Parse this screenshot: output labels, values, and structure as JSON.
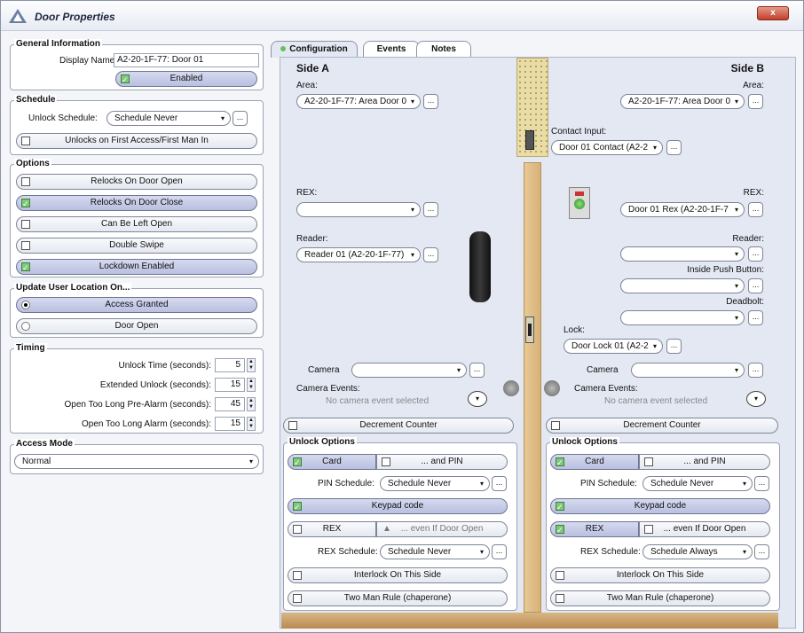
{
  "window": {
    "title": "Door Properties",
    "close_label": "x"
  },
  "general": {
    "title": "General Information",
    "display_name_label": "Display Name:",
    "display_name_value": "A2-20-1F-77: Door 01",
    "enabled_label": "Enabled"
  },
  "schedule": {
    "title": "Schedule",
    "unlock_label": "Unlock Schedule:",
    "unlock_value": "Schedule Never",
    "first_access_label": "Unlocks on First Access/First Man In"
  },
  "options": {
    "title": "Options",
    "items": [
      "Relocks On Door Open",
      "Relocks On Door Close",
      "Can Be Left Open",
      "Double Swipe",
      "Lockdown Enabled"
    ]
  },
  "update_location": {
    "title": "Update User Location On...",
    "items": [
      "Access Granted",
      "Door Open"
    ]
  },
  "timing": {
    "title": "Timing",
    "rows": [
      {
        "label": "Unlock Time (seconds):",
        "value": "5"
      },
      {
        "label": "Extended Unlock (seconds):",
        "value": "15"
      },
      {
        "label": "Open Too Long Pre-Alarm (seconds):",
        "value": "45"
      },
      {
        "label": "Open Too Long Alarm (seconds):",
        "value": "15"
      }
    ]
  },
  "access_mode": {
    "title": "Access Mode",
    "value": "Normal"
  },
  "tabs": [
    "Configuration",
    "Events",
    "Notes"
  ],
  "sideA": {
    "title": "Side A",
    "area_label": "Area:",
    "area_value": "A2-20-1F-77: Area Door 0",
    "rex_label": "REX:",
    "reader_label": "Reader:",
    "reader_value": "Reader 01 (A2-20-1F-77)",
    "camera_label": "Camera",
    "camera_events_label": "Camera Events:",
    "no_event": "No camera event selected",
    "decrement": "Decrement Counter",
    "unlock": {
      "title": "Unlock Options",
      "card": "Card",
      "and_pin": "... and PIN",
      "pin_schedule_label": "PIN Schedule:",
      "pin_schedule_value": "Schedule Never",
      "keypad": "Keypad code",
      "rex": "REX",
      "even_open": "... even If Door Open",
      "rex_schedule_label": "REX Schedule:",
      "rex_schedule_value": "Schedule Never",
      "interlock": "Interlock On This Side",
      "two_man": "Two Man Rule (chaperone)"
    }
  },
  "sideB": {
    "title": "Side B",
    "area_label": "Area:",
    "area_value": "A2-20-1F-77: Area Door 0",
    "contact_label": "Contact Input:",
    "contact_value": "Door 01 Contact (A2-2",
    "rex_label": "REX:",
    "rex_value": "Door 01 Rex (A2-20-1F-7",
    "reader_label": "Reader:",
    "push_label": "Inside Push Button:",
    "deadbolt_label": "Deadbolt:",
    "lock_label": "Lock:",
    "lock_value": "Door Lock 01  (A2-2",
    "camera_label": "Camera",
    "camera_events_label": "Camera Events:",
    "no_event": "No camera event selected",
    "decrement": "Decrement Counter",
    "unlock": {
      "title": "Unlock Options",
      "card": "Card",
      "and_pin": "... and PIN",
      "pin_schedule_label": "PIN Schedule:",
      "pin_schedule_value": "Schedule Never",
      "keypad": "Keypad code",
      "rex": "REX",
      "even_open": "... even If Door Open",
      "rex_schedule_label": "REX Schedule:",
      "rex_schedule_value": "Schedule Always",
      "interlock": "Interlock On This Side",
      "two_man": "Two Man Rule (chaperone)"
    }
  },
  "glyphs": {
    "arrow": "▾",
    "dots": "...",
    "circle_arrow": "▾"
  }
}
